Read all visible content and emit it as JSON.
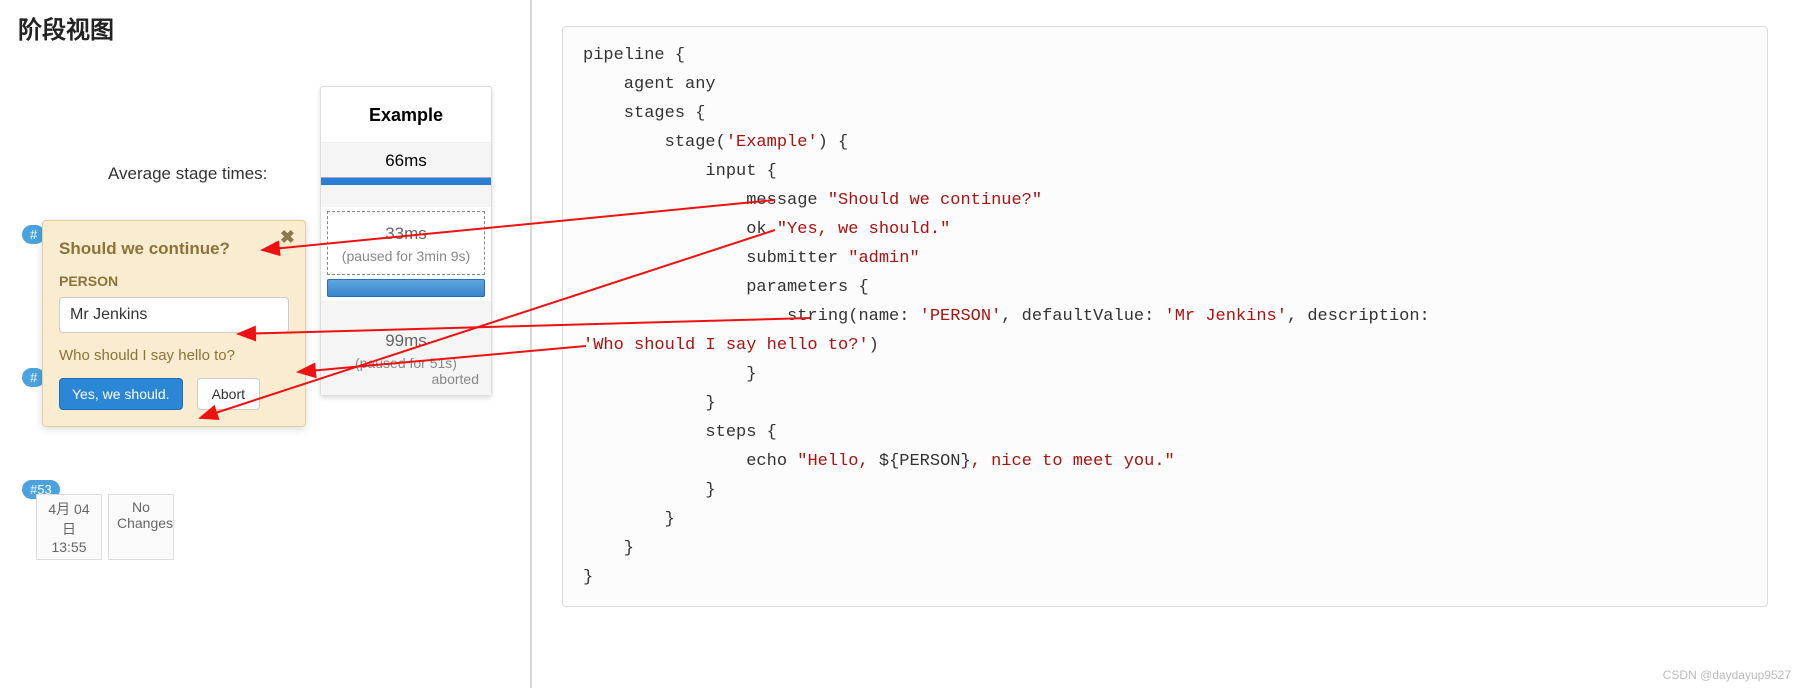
{
  "page": {
    "title": "阶段视图"
  },
  "stage": {
    "header": "Example",
    "avgLabel": "Average stage times:",
    "avgTime": "66ms",
    "run1": {
      "time": "33ms",
      "paused": "(paused for 3min 9s)"
    },
    "run2": {
      "time": "99ms",
      "paused": "(paused for 51s)",
      "status": "aborted"
    }
  },
  "runs": {
    "badge1": "#",
    "badge2": "#",
    "badge3": "#53",
    "date1": "4月 04",
    "date2": "日",
    "time": "13:55",
    "changes1": "No",
    "changes2": "Changes"
  },
  "popup": {
    "title": "Should we continue?",
    "paramLabel": "PERSON",
    "inputValue": "Mr Jenkins",
    "description": "Who should I say hello to?",
    "okLabel": "Yes, we should.",
    "abortLabel": "Abort"
  },
  "code": {
    "l1": "pipeline {",
    "l2": "    agent any",
    "l3": "    stages {",
    "l4a": "        stage(",
    "l4b": "'Example'",
    "l4c": ") {",
    "l5": "            input {",
    "l6a": "                message ",
    "l6b": "\"Should we continue?\"",
    "l7a": "                ok ",
    "l7b": "\"Yes, we should.\"",
    "l8a": "                submitter ",
    "l8b": "\"admin\"",
    "l9": "                parameters {",
    "l10a": "                    string(name: ",
    "l10b": "'PERSON'",
    "l10c": ", defaultValue: ",
    "l10d": "'Mr Jenkins'",
    "l10e": ", description: ",
    "l11a": "'Who should I say hello to?'",
    "l11b": ")",
    "l12": "                }",
    "l13": "            }",
    "l14": "            steps {",
    "l15a": "                echo ",
    "l15b": "\"Hello, ",
    "l15c": "${PERSON}",
    "l15d": ", nice to meet you.\"",
    "l16": "            }",
    "l17": "        }",
    "l18": "    }",
    "l19": "}"
  },
  "watermark": "CSDN @daydayup9527"
}
